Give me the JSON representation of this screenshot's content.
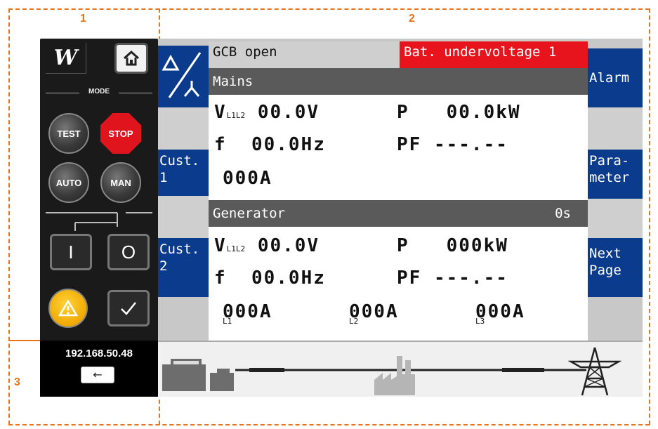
{
  "zones": {
    "z1": "1",
    "z2": "2",
    "z3": "3"
  },
  "colors": {
    "zone_annotation": "#e8731a",
    "softkey": "#0b3b8c",
    "alarm": "#e8141d",
    "section_header": "#5a5a5a"
  },
  "panel": {
    "logo": "W",
    "mode_label": "MODE",
    "test": "TEST",
    "stop": "STOP",
    "auto": "AUTO",
    "man": "MAN",
    "close_symbol": "I",
    "open_symbol": "O",
    "ip_address": "192.168.50.48",
    "back_glyph": "←",
    "icons": [
      "home-icon",
      "warning-icon",
      "checkmark-icon",
      "arrow-left-icon"
    ]
  },
  "screen": {
    "gcb_status": "GCB open",
    "alarm_text": "Bat. undervoltage 1",
    "left_keys": {
      "cust1": "Cust.\n1",
      "cust2": "Cust.\n2"
    },
    "right_keys": {
      "alarm": "Alarm",
      "parameter": "Para-\nmeter",
      "next_page": "Next\nPage"
    },
    "mains": {
      "title": "Mains",
      "v_label": "V",
      "v_sub": "L1L2",
      "v_value": "00.0V",
      "p_label": "P",
      "p_value": "00.0kW",
      "f_label": "f",
      "f_value": "00.0Hz",
      "pf_label": "PF",
      "pf_value": "---.--",
      "current": "000A"
    },
    "generator": {
      "title": "Generator",
      "timer": "0s",
      "v_label": "V",
      "v_sub": "L1L2",
      "v_value": "00.0V",
      "p_label": "P",
      "p_value": "000kW",
      "f_label": "f",
      "f_value": "00.0Hz",
      "pf_label": "PF",
      "pf_value": "---.--",
      "currents": [
        {
          "value": "000A",
          "phase": "L1"
        },
        {
          "value": "000A",
          "phase": "L2"
        },
        {
          "value": "000A",
          "phase": "L3"
        }
      ]
    }
  }
}
